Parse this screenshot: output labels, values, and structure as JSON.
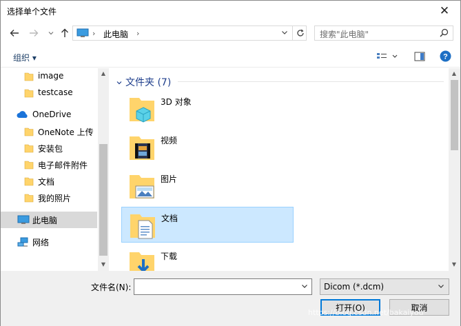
{
  "window": {
    "title": "选择单个文件",
    "close_icon": "✕"
  },
  "nav": {
    "back_icon": "arrow-left",
    "forward_icon": "arrow-right",
    "recent_icon": "chevron-down",
    "up_icon": "arrow-up",
    "address": {
      "location": "此电脑"
    },
    "search": {
      "placeholder": "搜索\"此电脑\""
    }
  },
  "toolbar": {
    "organize_label": "组织 ▾"
  },
  "sidebar": {
    "items": [
      {
        "label": "image",
        "icon": "folder-icon"
      },
      {
        "label": "testcase",
        "icon": "folder-icon"
      },
      {
        "label": "OneDrive",
        "icon": "cloud-icon"
      },
      {
        "label": "OneNote 上传",
        "icon": "folder-icon"
      },
      {
        "label": "安装包",
        "icon": "folder-icon"
      },
      {
        "label": "电子邮件附件",
        "icon": "folder-icon"
      },
      {
        "label": "文档",
        "icon": "folder-icon"
      },
      {
        "label": "我的照片",
        "icon": "folder-icon"
      },
      {
        "label": "此电脑",
        "icon": "pc-icon"
      },
      {
        "label": "网络",
        "icon": "network-icon"
      }
    ]
  },
  "content": {
    "group_header": "文件夹 (7)",
    "folders": [
      {
        "label": "3D 对象"
      },
      {
        "label": "视频"
      },
      {
        "label": "图片"
      },
      {
        "label": "文档"
      },
      {
        "label": "下载"
      }
    ]
  },
  "footer": {
    "filename_label": "文件名(N):",
    "filename_value": "",
    "filetype_value": "Dicom (*.dcm)",
    "open_label": "打开(O)",
    "cancel_label": "取消"
  },
  "watermark": "https://blog.csdn.net/bakaiyou",
  "colors": {
    "accent": "#0078d7",
    "selected": "#cce8ff",
    "folder": "#ffd46b",
    "heading": "#1e3e8c"
  }
}
